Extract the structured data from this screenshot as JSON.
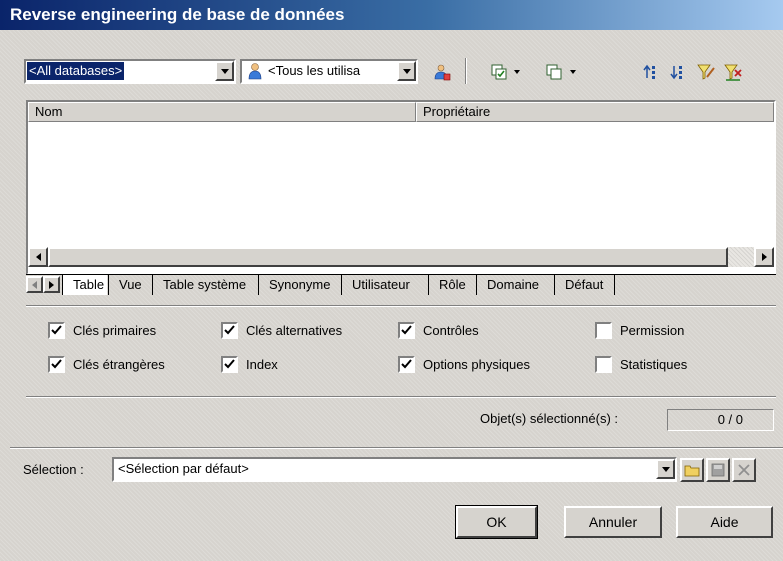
{
  "window": {
    "title": "Reverse engineering de base de données"
  },
  "toolbar": {
    "database_combo": {
      "value": "<All databases>"
    },
    "owner_combo": {
      "value": "<Tous les utilisa",
      "icon": "user-icon"
    },
    "icons": [
      "select-owner-icon",
      "select-all-icon",
      "deselect-all-icon",
      "move-up-icon",
      "move-down-icon",
      "filter-icon",
      "clear-filter-icon"
    ]
  },
  "object_list": {
    "columns": [
      "Nom",
      "Propriétaire"
    ],
    "rows": []
  },
  "tabs": [
    {
      "label": "Table",
      "active": true
    },
    {
      "label": "Vue",
      "active": false
    },
    {
      "label": "Table système",
      "active": false
    },
    {
      "label": "Synonyme",
      "active": false
    },
    {
      "label": "Utilisateur",
      "active": false
    },
    {
      "label": "Rôle",
      "active": false
    },
    {
      "label": "Domaine",
      "active": false
    },
    {
      "label": "Défaut",
      "active": false
    }
  ],
  "options": [
    {
      "label": "Clés primaires",
      "checked": true
    },
    {
      "label": "Clés alternatives",
      "checked": true
    },
    {
      "label": "Contrôles",
      "checked": true
    },
    {
      "label": "Permission",
      "checked": false
    },
    {
      "label": "Clés étrangères",
      "checked": true
    },
    {
      "label": "Index",
      "checked": true
    },
    {
      "label": "Options physiques",
      "checked": true
    },
    {
      "label": "Statistiques",
      "checked": false
    }
  ],
  "selected_objects": {
    "label": "Objet(s) sélectionné(s) :",
    "value": "0 / 0"
  },
  "selection": {
    "label": "Sélection :",
    "value": "<Sélection par défaut>"
  },
  "buttons": {
    "ok": "OK",
    "cancel": "Annuler",
    "help": "Aide"
  }
}
